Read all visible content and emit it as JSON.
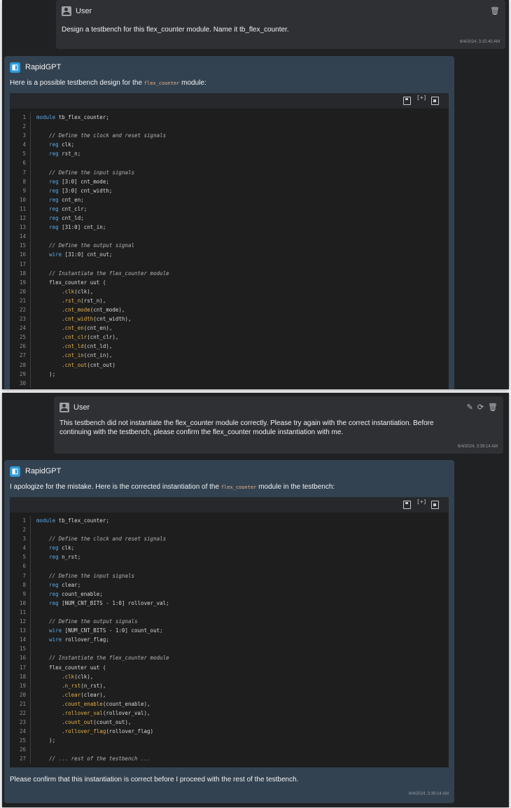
{
  "shot1": {
    "user": {
      "name": "User",
      "text": "Design a testbench for this flex_counter module. Name it tb_flex_counter.",
      "timestamp": "6/4/2024, 3:15:40 AM",
      "actions": [
        "trash-icon"
      ]
    },
    "assistant": {
      "name": "RapidGPT",
      "intro_before": "Here is a possible testbench design for the",
      "intro_code": "flex_counter",
      "intro_after": "module:",
      "code_lines": [
        {
          "n": "1",
          "tokens": [
            {
              "k": "kw",
              "t": "module"
            },
            {
              "k": "ct",
              "t": " tb_flex_counter;"
            }
          ]
        },
        {
          "n": "2",
          "tokens": []
        },
        {
          "n": "3",
          "tokens": [
            {
              "k": "ct",
              "t": "    "
            },
            {
              "k": "cm",
              "t": "// Define the clock and reset signals"
            }
          ]
        },
        {
          "n": "4",
          "tokens": [
            {
              "k": "ct",
              "t": "    "
            },
            {
              "k": "kw",
              "t": "reg"
            },
            {
              "k": "ct",
              "t": " clk;"
            }
          ]
        },
        {
          "n": "5",
          "tokens": [
            {
              "k": "ct",
              "t": "    "
            },
            {
              "k": "kw",
              "t": "reg"
            },
            {
              "k": "ct",
              "t": " rst_n;"
            }
          ]
        },
        {
          "n": "6",
          "tokens": []
        },
        {
          "n": "7",
          "tokens": [
            {
              "k": "ct",
              "t": "    "
            },
            {
              "k": "cm",
              "t": "// Define the input signals"
            }
          ]
        },
        {
          "n": "8",
          "tokens": [
            {
              "k": "ct",
              "t": "    "
            },
            {
              "k": "kw",
              "t": "reg"
            },
            {
              "k": "ct",
              "t": " [3:0] cnt_mode;"
            }
          ]
        },
        {
          "n": "9",
          "tokens": [
            {
              "k": "ct",
              "t": "    "
            },
            {
              "k": "kw",
              "t": "reg"
            },
            {
              "k": "ct",
              "t": " [3:0] cnt_width;"
            }
          ]
        },
        {
          "n": "10",
          "tokens": [
            {
              "k": "ct",
              "t": "    "
            },
            {
              "k": "kw",
              "t": "reg"
            },
            {
              "k": "ct",
              "t": " cnt_en;"
            }
          ]
        },
        {
          "n": "11",
          "tokens": [
            {
              "k": "ct",
              "t": "    "
            },
            {
              "k": "kw",
              "t": "reg"
            },
            {
              "k": "ct",
              "t": " cnt_clr;"
            }
          ]
        },
        {
          "n": "12",
          "tokens": [
            {
              "k": "ct",
              "t": "    "
            },
            {
              "k": "kw",
              "t": "reg"
            },
            {
              "k": "ct",
              "t": " cnt_ld;"
            }
          ]
        },
        {
          "n": "13",
          "tokens": [
            {
              "k": "ct",
              "t": "    "
            },
            {
              "k": "kw",
              "t": "reg"
            },
            {
              "k": "ct",
              "t": " [31:0] cnt_in;"
            }
          ]
        },
        {
          "n": "14",
          "tokens": []
        },
        {
          "n": "15",
          "tokens": [
            {
              "k": "ct",
              "t": "    "
            },
            {
              "k": "cm",
              "t": "// Define the output signal"
            }
          ]
        },
        {
          "n": "16",
          "tokens": [
            {
              "k": "ct",
              "t": "    "
            },
            {
              "k": "kw",
              "t": "wire"
            },
            {
              "k": "ct",
              "t": " [31:0] cnt_out;"
            }
          ]
        },
        {
          "n": "17",
          "tokens": []
        },
        {
          "n": "18",
          "tokens": [
            {
              "k": "ct",
              "t": "    "
            },
            {
              "k": "cm",
              "t": "// Instantiate the flex_counter module"
            }
          ]
        },
        {
          "n": "19",
          "tokens": [
            {
              "k": "ct",
              "t": "    flex_counter uut ("
            }
          ]
        },
        {
          "n": "20",
          "tokens": [
            {
              "k": "ct",
              "t": "        "
            },
            {
              "k": "pt",
              "t": ".clk"
            },
            {
              "k": "ct",
              "t": "(clk),"
            }
          ]
        },
        {
          "n": "21",
          "tokens": [
            {
              "k": "ct",
              "t": "        "
            },
            {
              "k": "pt",
              "t": ".rst_n"
            },
            {
              "k": "ct",
              "t": "(rst_n),"
            }
          ]
        },
        {
          "n": "22",
          "tokens": [
            {
              "k": "ct",
              "t": "        "
            },
            {
              "k": "pt",
              "t": ".cnt_mode"
            },
            {
              "k": "ct",
              "t": "(cnt_mode),"
            }
          ]
        },
        {
          "n": "23",
          "tokens": [
            {
              "k": "ct",
              "t": "        "
            },
            {
              "k": "pt",
              "t": ".cnt_width"
            },
            {
              "k": "ct",
              "t": "(cnt_width),"
            }
          ]
        },
        {
          "n": "24",
          "tokens": [
            {
              "k": "ct",
              "t": "        "
            },
            {
              "k": "pt",
              "t": ".cnt_en"
            },
            {
              "k": "ct",
              "t": "(cnt_en),"
            }
          ]
        },
        {
          "n": "25",
          "tokens": [
            {
              "k": "ct",
              "t": "        "
            },
            {
              "k": "pt",
              "t": ".cnt_clr"
            },
            {
              "k": "ct",
              "t": "(cnt_clr),"
            }
          ]
        },
        {
          "n": "26",
          "tokens": [
            {
              "k": "ct",
              "t": "        "
            },
            {
              "k": "pt",
              "t": ".cnt_ld"
            },
            {
              "k": "ct",
              "t": "(cnt_ld),"
            }
          ]
        },
        {
          "n": "27",
          "tokens": [
            {
              "k": "ct",
              "t": "        "
            },
            {
              "k": "pt",
              "t": ".cnt_in"
            },
            {
              "k": "ct",
              "t": "(cnt_in),"
            }
          ]
        },
        {
          "n": "28",
          "tokens": [
            {
              "k": "ct",
              "t": "        "
            },
            {
              "k": "pt",
              "t": ".cnt_out"
            },
            {
              "k": "ct",
              "t": "(cnt_out)"
            }
          ]
        },
        {
          "n": "29",
          "tokens": [
            {
              "k": "ct",
              "t": "    );"
            }
          ]
        },
        {
          "n": "30",
          "tokens": []
        }
      ]
    }
  },
  "shot2": {
    "user": {
      "name": "User",
      "text_line1": "This testbench did not instantiate the flex_counter module correctly. Please try again with the correct instantiation. Before",
      "text_line2": "continuing with the testbench, please confirm the flex_counter module instantiation with me.",
      "timestamp": "6/4/2024, 3:39:14 AM",
      "actions": [
        "pencil-icon",
        "refresh-icon",
        "trash-icon"
      ]
    },
    "assistant": {
      "name": "RapidGPT",
      "intro_before": "I apologize for the mistake. Here is the corrected instantiation of the",
      "intro_code": "flex_counter",
      "intro_after": "module in the testbench:",
      "code_lines": [
        {
          "n": "1",
          "tokens": [
            {
              "k": "kw",
              "t": "module"
            },
            {
              "k": "ct",
              "t": " tb_flex_counter;"
            }
          ]
        },
        {
          "n": "2",
          "tokens": []
        },
        {
          "n": "3",
          "tokens": [
            {
              "k": "ct",
              "t": "    "
            },
            {
              "k": "cm",
              "t": "// Define the clock and reset signals"
            }
          ]
        },
        {
          "n": "4",
          "tokens": [
            {
              "k": "ct",
              "t": "    "
            },
            {
              "k": "kw",
              "t": "reg"
            },
            {
              "k": "ct",
              "t": " clk;"
            }
          ]
        },
        {
          "n": "5",
          "tokens": [
            {
              "k": "ct",
              "t": "    "
            },
            {
              "k": "kw",
              "t": "reg"
            },
            {
              "k": "ct",
              "t": " n_rst;"
            }
          ]
        },
        {
          "n": "6",
          "tokens": []
        },
        {
          "n": "7",
          "tokens": [
            {
              "k": "ct",
              "t": "    "
            },
            {
              "k": "cm",
              "t": "// Define the input signals"
            }
          ]
        },
        {
          "n": "8",
          "tokens": [
            {
              "k": "ct",
              "t": "    "
            },
            {
              "k": "kw",
              "t": "reg"
            },
            {
              "k": "ct",
              "t": " clear;"
            }
          ]
        },
        {
          "n": "9",
          "tokens": [
            {
              "k": "ct",
              "t": "    "
            },
            {
              "k": "kw",
              "t": "reg"
            },
            {
              "k": "ct",
              "t": " count_enable;"
            }
          ]
        },
        {
          "n": "10",
          "tokens": [
            {
              "k": "ct",
              "t": "    "
            },
            {
              "k": "kw",
              "t": "reg"
            },
            {
              "k": "ct",
              "t": " [NUM_CNT_BITS - 1:0] rollover_val;"
            }
          ]
        },
        {
          "n": "11",
          "tokens": []
        },
        {
          "n": "12",
          "tokens": [
            {
              "k": "ct",
              "t": "    "
            },
            {
              "k": "cm",
              "t": "// Define the output signals"
            }
          ]
        },
        {
          "n": "13",
          "tokens": [
            {
              "k": "ct",
              "t": "    "
            },
            {
              "k": "kw",
              "t": "wire"
            },
            {
              "k": "ct",
              "t": " [NUM_CNT_BITS - 1:0] count_out;"
            }
          ]
        },
        {
          "n": "14",
          "tokens": [
            {
              "k": "ct",
              "t": "    "
            },
            {
              "k": "kw",
              "t": "wire"
            },
            {
              "k": "ct",
              "t": " rollover_flag;"
            }
          ]
        },
        {
          "n": "15",
          "tokens": []
        },
        {
          "n": "16",
          "tokens": [
            {
              "k": "ct",
              "t": "    "
            },
            {
              "k": "cm",
              "t": "// Instantiate the flex_counter module"
            }
          ]
        },
        {
          "n": "17",
          "tokens": [
            {
              "k": "ct",
              "t": "    flex_counter uut ("
            }
          ]
        },
        {
          "n": "18",
          "tokens": [
            {
              "k": "ct",
              "t": "        "
            },
            {
              "k": "pt",
              "t": ".clk"
            },
            {
              "k": "ct",
              "t": "(clk),"
            }
          ]
        },
        {
          "n": "19",
          "tokens": [
            {
              "k": "ct",
              "t": "        "
            },
            {
              "k": "pt",
              "t": ".n_rst"
            },
            {
              "k": "ct",
              "t": "(n_rst),"
            }
          ]
        },
        {
          "n": "20",
          "tokens": [
            {
              "k": "ct",
              "t": "        "
            },
            {
              "k": "pt",
              "t": ".clear"
            },
            {
              "k": "ct",
              "t": "(clear),"
            }
          ]
        },
        {
          "n": "21",
          "tokens": [
            {
              "k": "ct",
              "t": "        "
            },
            {
              "k": "pt",
              "t": ".count_enable"
            },
            {
              "k": "ct",
              "t": "(count_enable),"
            }
          ]
        },
        {
          "n": "22",
          "tokens": [
            {
              "k": "ct",
              "t": "        "
            },
            {
              "k": "pt",
              "t": ".rollover_val"
            },
            {
              "k": "ct",
              "t": "(rollover_val),"
            }
          ]
        },
        {
          "n": "23",
          "tokens": [
            {
              "k": "ct",
              "t": "        "
            },
            {
              "k": "pt",
              "t": ".count_out"
            },
            {
              "k": "ct",
              "t": "(count_out),"
            }
          ]
        },
        {
          "n": "24",
          "tokens": [
            {
              "k": "ct",
              "t": "        "
            },
            {
              "k": "pt",
              "t": ".rollover_flag"
            },
            {
              "k": "ct",
              "t": "(rollover_flag)"
            }
          ]
        },
        {
          "n": "25",
          "tokens": [
            {
              "k": "ct",
              "t": "    );"
            }
          ]
        },
        {
          "n": "26",
          "tokens": []
        },
        {
          "n": "27",
          "tokens": [
            {
              "k": "ct",
              "t": "    "
            },
            {
              "k": "cm",
              "t": "// ... rest of the testbench ..."
            }
          ]
        }
      ],
      "outro": "Please confirm that this instantiation is correct before I proceed with the rest of the testbench.",
      "timestamp": "6/4/2024, 3:39:14 AM"
    }
  },
  "code_toolbar_icons": [
    "save-icon",
    "expand-icon",
    "clipboard-icon"
  ],
  "colors": {
    "app_bg": "#202123",
    "user_bg": "#2f3033",
    "assistant_bg": "#334250",
    "code_bg": "#1e1e1e",
    "keyword": "#5aa8e6",
    "property": "#e4b04a",
    "comment": "#b3b3b3"
  }
}
